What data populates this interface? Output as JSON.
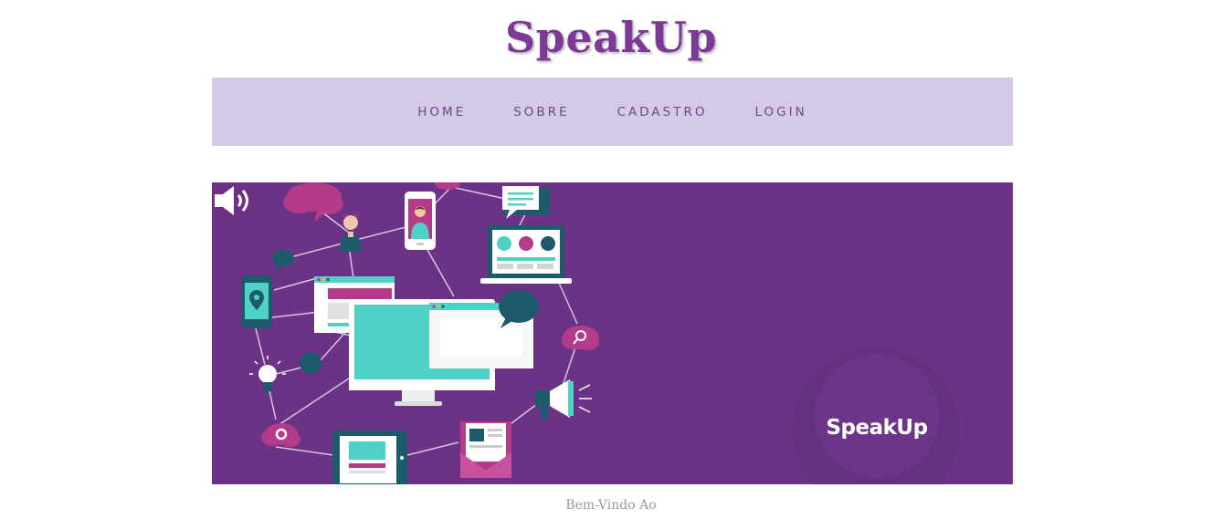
{
  "site": {
    "title": "SpeakUp"
  },
  "nav": {
    "items": [
      "HOME",
      "SOBRE",
      "CADASTRO",
      "LOGIN"
    ]
  },
  "hero": {
    "logo_text": "SpeakUp",
    "icons": [
      "chat-bubble-icon",
      "person-icon",
      "smartphone-icon",
      "laptop-icon",
      "location-pin-icon",
      "browser-window-icon",
      "desktop-monitor-icon",
      "search-cloud-icon",
      "lightbulb-icon",
      "megaphone-icon",
      "settings-cloud-icon",
      "tablet-icon",
      "envelope-icon",
      "speaker-icon"
    ],
    "colors": {
      "background": "#6b3285",
      "teal": "#4fd1c5",
      "magenta": "#b43a8a",
      "dark_teal": "#1d5a6b"
    }
  },
  "welcome": {
    "text": "Bem-Vindo Ao"
  }
}
